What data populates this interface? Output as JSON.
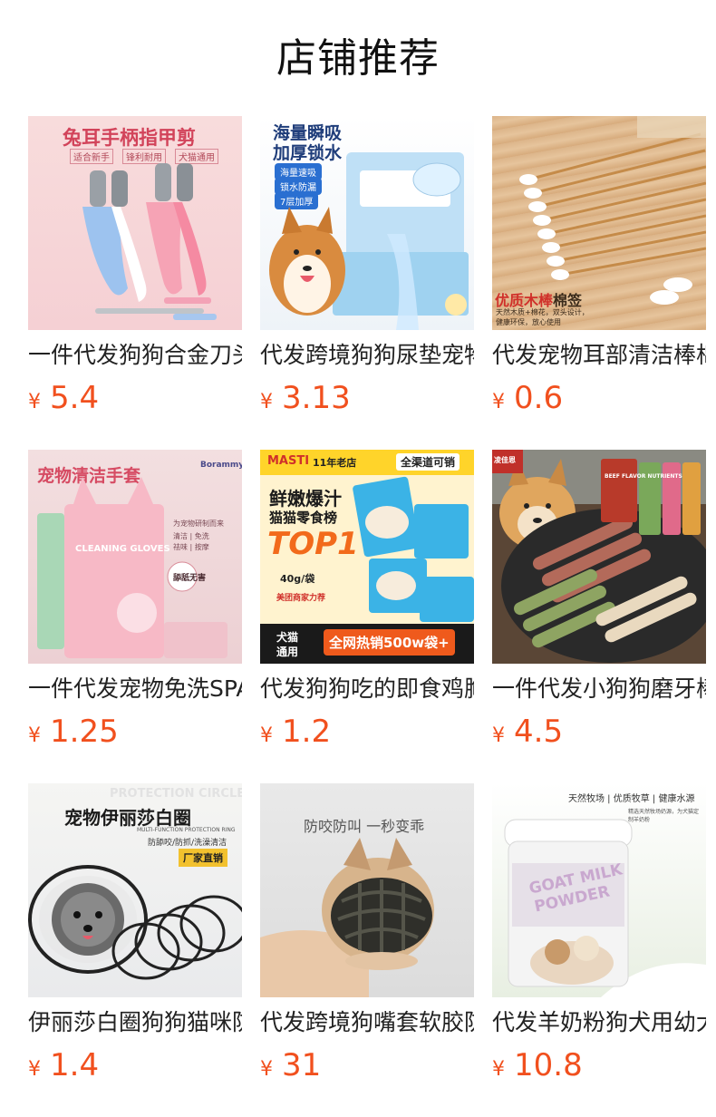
{
  "page": {
    "title": "店铺推荐"
  },
  "currency_symbol": "¥",
  "products": [
    {
      "name": "一件代发狗狗合金刀头指甲剪",
      "price": "5.4",
      "image_text": {
        "headline": "兔耳手柄指甲剪",
        "tags": [
          "适合新手",
          "锋利耐用",
          "犬猫通用"
        ]
      }
    },
    {
      "name": "代发跨境狗狗尿垫宠物",
      "price": "3.13",
      "image_text": {
        "headline1": "海量瞬吸",
        "headline2": "加厚锁水",
        "tags": [
          "海量速吸",
          "锁水防漏",
          "7层加厚"
        ]
      }
    },
    {
      "name": "代发宠物耳部清洁棒棉签",
      "price": "0.6",
      "image_text": {
        "label_a": "优质木棒",
        "label_b": "棉签",
        "sub1": "天然木质+棉花，双头设计，",
        "sub2": "健康环保，放心使用"
      }
    },
    {
      "name": "一件代发宠物免洗SPA手套",
      "price": "1.25",
      "image_text": {
        "headline": "宠物清洁手套",
        "brand": "Borammy",
        "pack": "CLEANING GLOVES",
        "badge": "舔舐无害",
        "features": [
          "为宠物研制而来",
          "清洁 | 免洗",
          "祛味 | 按摩"
        ]
      }
    },
    {
      "name": "代发狗狗吃的即食鸡胸肉",
      "price": "1.2",
      "image_text": {
        "brand": "MASTI",
        "store": "11年老店",
        "channel": "全渠道可销",
        "line1": "鲜嫩爆汁",
        "line2": "猫猫零食榜",
        "rank": "TOP1",
        "weight": "40g/袋",
        "rec": "美团商家力荐",
        "side1": "犬猫",
        "side2": "通用",
        "banner": "全网热销500w袋+"
      }
    },
    {
      "name": "一件代发小狗狗磨牙棒",
      "price": "4.5",
      "image_text": {
        "pack": "BEEF FLAVOR NUTRIENTS",
        "logo": "凌佳恩"
      }
    },
    {
      "name": "伊丽莎白圈狗狗猫咪防舔",
      "price": "1.4",
      "image_text": {
        "watermark": "PROTECTION CIRCLE",
        "headline": "宠物伊丽莎白圈",
        "sub_en": "MULTI-FUNCTION PROTECTION RING",
        "sub": "防舔咬/防抓/洗澡清洁",
        "badge": "厂家直销"
      }
    },
    {
      "name": "代发跨境狗嘴套软胶防咬",
      "price": "31",
      "image_text": {
        "headline": "防咬防叫 一秒变乖"
      }
    },
    {
      "name": "代发羊奶粉狗犬用幼犬",
      "price": "10.8",
      "image_text": {
        "top": "天然牧场 | 优质牧草 | 健康水源",
        "can1": "GOAT MILK",
        "can2": "POWDER",
        "desc": "精选天然牧场奶源，为犬猫定制羊奶粉"
      }
    }
  ]
}
